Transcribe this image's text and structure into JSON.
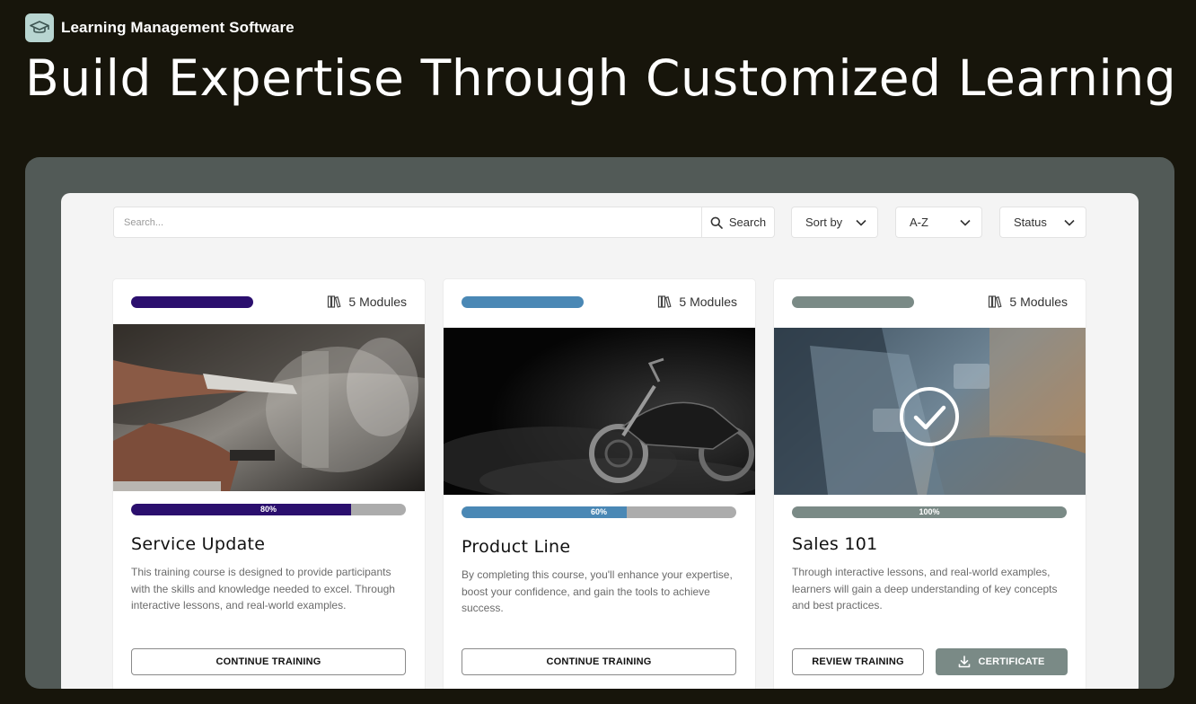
{
  "app": {
    "name": "Learning Management Software",
    "logo_icon": "graduation-cap-icon"
  },
  "hero": {
    "title": "Build Expertise Through Customized Learning"
  },
  "toolbar": {
    "search_placeholder": "Search...",
    "search_value": "",
    "search_button_label": "Search",
    "search_icon": "search-icon",
    "sort_label": "Sort by",
    "order_label": "A-Z",
    "status_label": "Status"
  },
  "cards": [
    {
      "modules_label": "5 Modules",
      "accent_color": "#2b0f6e",
      "progress_percent": 80,
      "progress_label": "80%",
      "title": "Service Update",
      "description": "This training course is designed to provide participants with the skills and knowledge needed to excel. Through interactive lessons, and real-world examples.",
      "primary_button": "CONTINUE TRAINING",
      "image": "mechanic-working-on-engine"
    },
    {
      "modules_label": "5 Modules",
      "accent_color": "#4a88b5",
      "progress_percent": 60,
      "progress_label": "60%",
      "title": "Product Line",
      "description": "By completing this course, you'll enhance your expertise, boost your confidence, and gain the tools to achieve success.",
      "primary_button": "CONTINUE TRAINING",
      "image": "motorcycle-in-dark-smoke"
    },
    {
      "modules_label": "5 Modules",
      "accent_color": "#7a8a86",
      "progress_percent": 100,
      "progress_label": "100%",
      "title": "Sales 101",
      "description": "Through interactive lessons, and real-world examples, learners will gain a deep understanding of key concepts and best practices.",
      "primary_button": "REVIEW TRAINING",
      "secondary_button": "CERTIFICATE",
      "image": "laptop-with-checkmark"
    }
  ]
}
